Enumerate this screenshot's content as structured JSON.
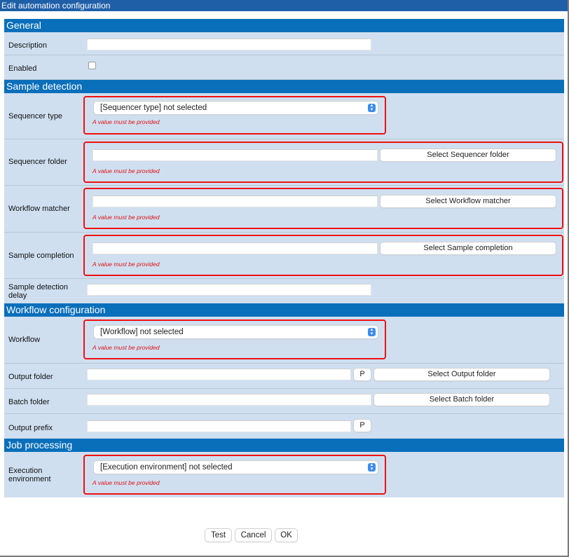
{
  "window": {
    "title": "Edit automation configuration"
  },
  "validation_message": "A value must be provided",
  "sections": {
    "general": {
      "title": "General",
      "description": {
        "label": "Description",
        "value": ""
      },
      "enabled": {
        "label": "Enabled",
        "checked": false
      }
    },
    "sample_detection": {
      "title": "Sample detection",
      "sequencer_type": {
        "label": "Sequencer type",
        "selected": "[Sequencer type] not selected",
        "error": "A value must be provided"
      },
      "sequencer_folder": {
        "label": "Sequencer folder",
        "value": "",
        "button": "Select Sequencer folder",
        "error": "A value must be provided"
      },
      "workflow_matcher": {
        "label": "Workflow matcher",
        "value": "",
        "button": "Select Workflow matcher",
        "error": "A value must be provided"
      },
      "sample_completion": {
        "label": "Sample completion",
        "value": "",
        "button": "Select Sample completion",
        "error": "A value must be provided"
      },
      "sample_detection_delay": {
        "label_line1": "Sample detection",
        "label_line2": "delay",
        "value": ""
      }
    },
    "workflow_configuration": {
      "title": "Workflow configuration",
      "workflow": {
        "label": "Workflow",
        "selected": "[Workflow] not selected",
        "error": "A value must be provided"
      },
      "output_folder": {
        "label": "Output folder",
        "value": "",
        "p_button": "P",
        "button": "Select Output folder"
      },
      "batch_folder": {
        "label": "Batch folder",
        "value": "",
        "button": "Select Batch folder"
      },
      "output_prefix": {
        "label": "Output prefix",
        "value": "",
        "p_button": "P"
      }
    },
    "job_processing": {
      "title": "Job processing",
      "execution_environment": {
        "label_line1": "Execution",
        "label_line2": "environment",
        "selected": "[Execution environment] not selected",
        "error": "A value must be provided"
      }
    }
  },
  "footer": {
    "test": "Test",
    "cancel": "Cancel",
    "ok": "OK"
  },
  "colors": {
    "section_header": "#0a6fba",
    "title_bar": "#1f5fa8",
    "row_bg": "#cfdff0",
    "error": "#ee1111",
    "select_arrow": "#3b8cf0"
  }
}
